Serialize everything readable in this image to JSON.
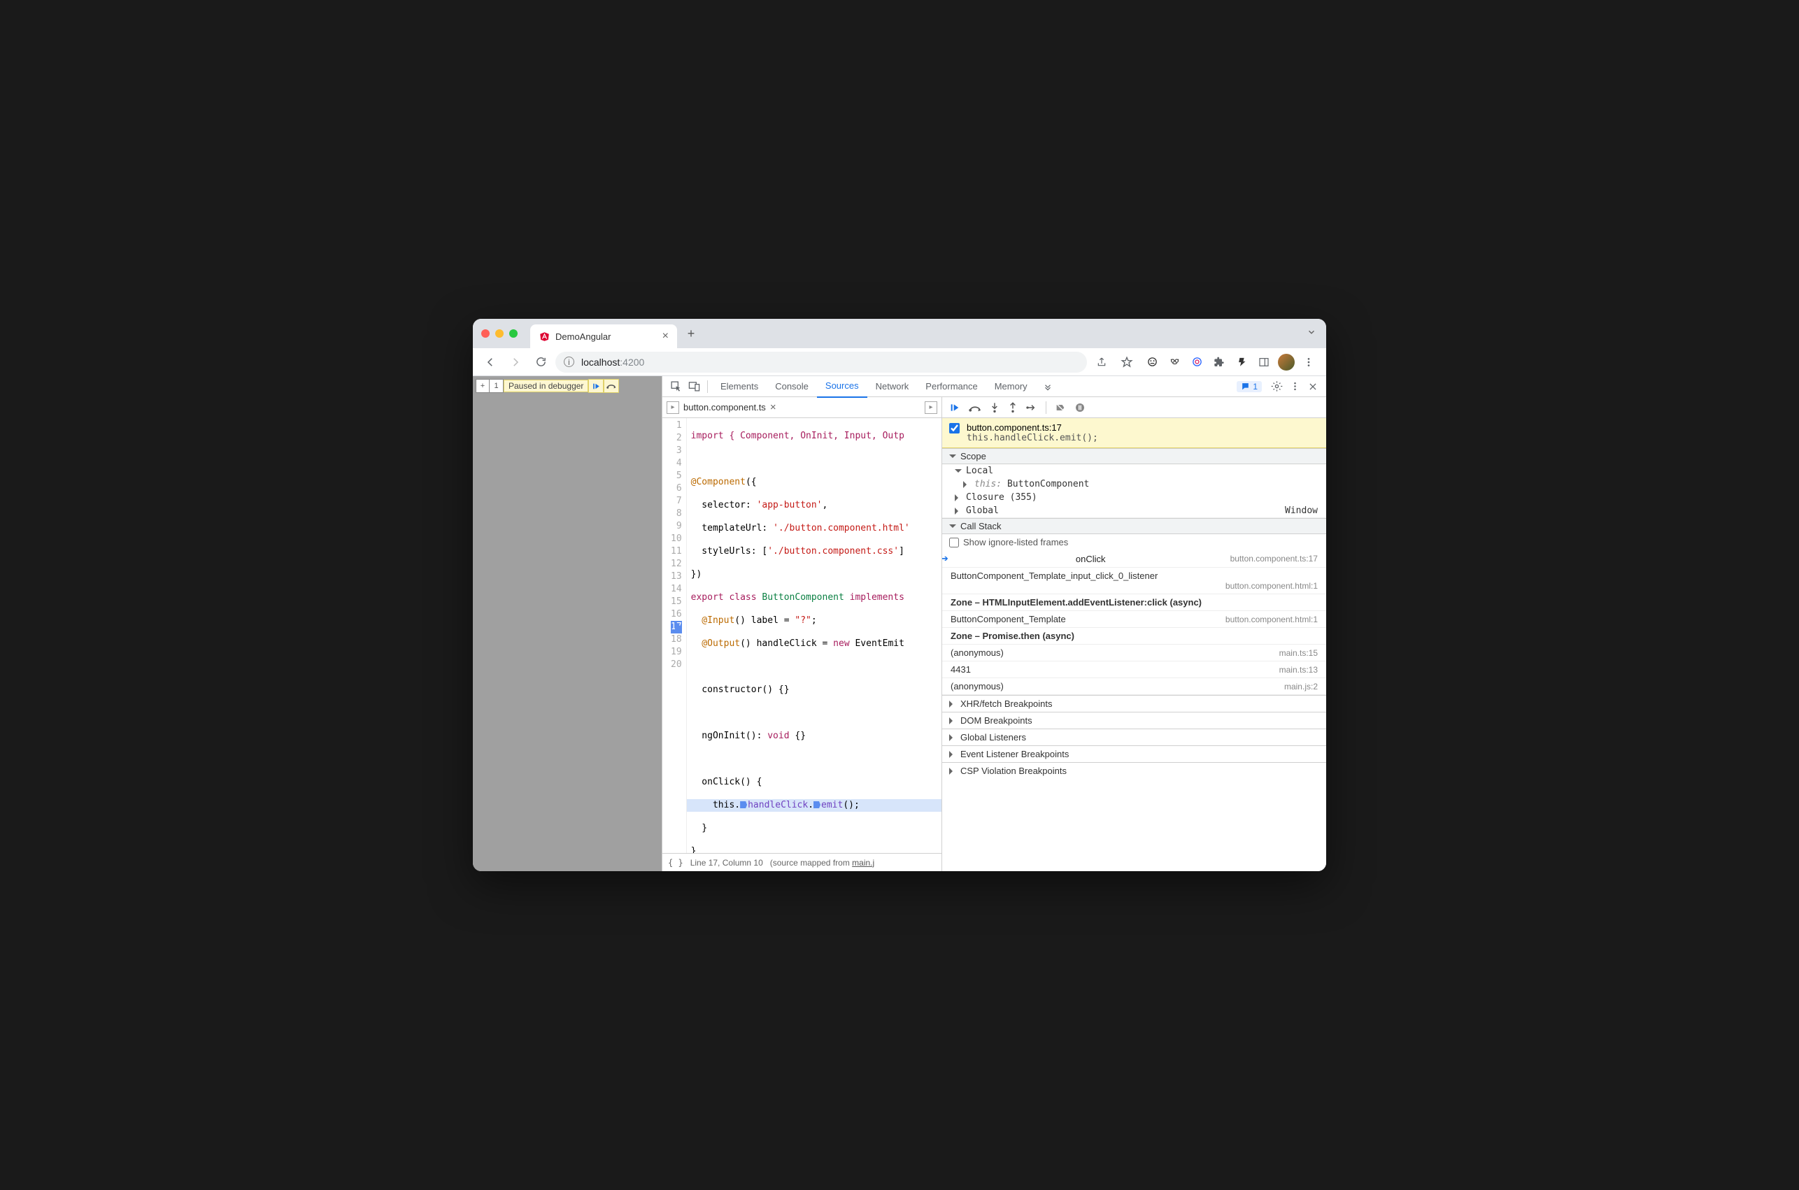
{
  "browser": {
    "tab_title": "DemoAngular",
    "url_host": "localhost",
    "url_port": ":4200"
  },
  "paused_chip": {
    "label": "Paused in debugger"
  },
  "devtools": {
    "tabs": [
      "Elements",
      "Console",
      "Sources",
      "Network",
      "Performance",
      "Memory"
    ],
    "active_tab": "Sources",
    "issues_count": "1"
  },
  "editor": {
    "filename": "button.component.ts",
    "status": "Line 17, Column 10",
    "status_prefix": "(source mapped from ",
    "mapped_from": "main.j",
    "gutter": [
      "1",
      "2",
      "3",
      "4",
      "5",
      "6",
      "7",
      "8",
      "9",
      "10",
      "11",
      "12",
      "13",
      "14",
      "15",
      "16",
      "17",
      "18",
      "19",
      "20"
    ],
    "highlight_line": 17
  },
  "code": {
    "l1": "import { Component, OnInit, Input, Outp",
    "l3a": "@Component",
    "l3b": "({",
    "l4a": "  selector: ",
    "l4b": "'app-button'",
    "l4c": ",",
    "l5a": "  templateUrl: ",
    "l5b": "'./button.component.html'",
    "l6a": "  styleUrls: [",
    "l6b": "'./button.component.css'",
    "l6c": "]",
    "l7": "})",
    "l8a": "export class ",
    "l8b": "ButtonComponent",
    "l8c": " implements",
    "l9a": "  @Input",
    "l9b": "() label = ",
    "l9c": "\"?\"",
    "l9d": ";",
    "l10a": "  @Output",
    "l10b": "() handleClick = ",
    "l10c": "new",
    "l10d": " EventEmit",
    "l12": "  constructor() {}",
    "l14a": "  ngOnInit(): ",
    "l14b": "void",
    "l14c": " {}",
    "l16": "  onClick() {",
    "l17a": "    this.",
    "l17b": "handleClick",
    "l17c": ".",
    "l17d": "emit",
    "l17e": "();",
    "l18": "  }",
    "l19": "}"
  },
  "breakpoint": {
    "file": "button.component.ts:17",
    "expr": "this.handleClick.emit();"
  },
  "scope": {
    "header": "Scope",
    "local": "Local",
    "this_lbl": "this:",
    "this_val": "ButtonComponent",
    "closure": "Closure (355)",
    "global": "Global",
    "global_val": "Window"
  },
  "callstack": {
    "header": "Call Stack",
    "show_ignore": "Show ignore-listed frames",
    "rows": [
      {
        "fn": "onClick",
        "loc": "button.component.ts:17",
        "active": true
      },
      {
        "fn": "ButtonComponent_Template_input_click_0_listener",
        "loc": "button.component.html:1"
      },
      {
        "fn": "Zone – HTMLInputElement.addEventListener:click (async)",
        "zone": true
      },
      {
        "fn": "ButtonComponent_Template",
        "loc": "button.component.html:1"
      },
      {
        "fn": "Zone – Promise.then (async)",
        "zone": true
      },
      {
        "fn": "(anonymous)",
        "loc": "main.ts:15"
      },
      {
        "fn": "4431",
        "loc": "main.ts:13"
      },
      {
        "fn": "(anonymous)",
        "loc": "main.js:2"
      }
    ]
  },
  "collapsed_sections": [
    "XHR/fetch Breakpoints",
    "DOM Breakpoints",
    "Global Listeners",
    "Event Listener Breakpoints",
    "CSP Violation Breakpoints"
  ]
}
